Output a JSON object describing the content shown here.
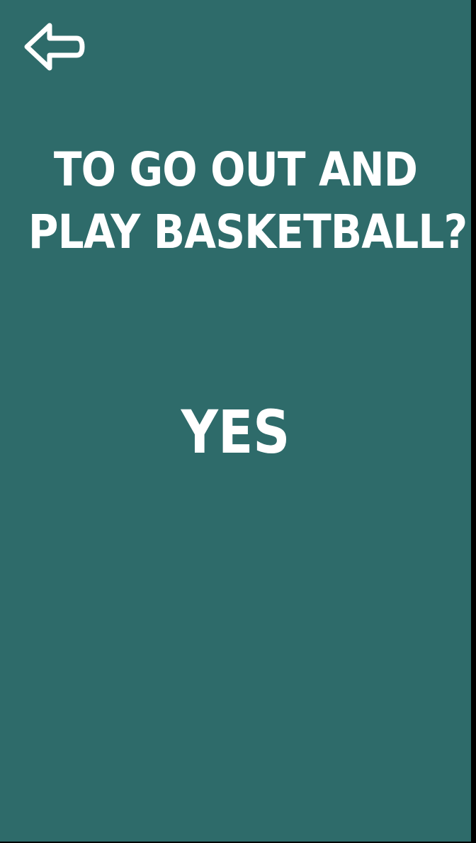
{
  "back": {
    "icon": "arrow-left-icon"
  },
  "question": {
    "line1": "TO GO OUT AND",
    "line2": "PLAY BASKETBALL?"
  },
  "answer": {
    "label": "YES"
  },
  "colors": {
    "background": "#2e6b6a",
    "text": "#ffffff"
  }
}
